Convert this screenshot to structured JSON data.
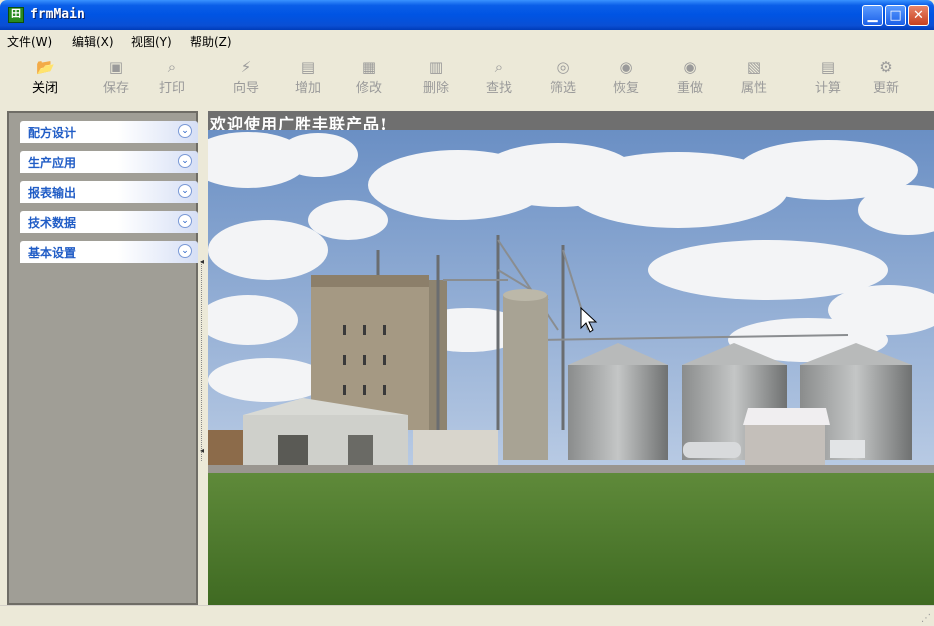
{
  "window": {
    "title": "frmMain",
    "app_icon": "app-icon"
  },
  "menu": [
    "文件(W)",
    "编辑(X)",
    "视图(Y)",
    "帮助(Z)"
  ],
  "toolbar": [
    {
      "label": "关闭",
      "icon": "open-folder-icon",
      "enabled": true
    },
    {
      "label": "保存",
      "icon": "save-icon",
      "enabled": false
    },
    {
      "label": "打印",
      "icon": "print-icon",
      "enabled": false
    },
    {
      "label": "向导",
      "icon": "wizard-icon",
      "enabled": false
    },
    {
      "label": "增加",
      "icon": "add-icon",
      "enabled": false
    },
    {
      "label": "修改",
      "icon": "edit-icon",
      "enabled": false
    },
    {
      "label": "删除",
      "icon": "delete-icon",
      "enabled": false
    },
    {
      "label": "查找",
      "icon": "find-icon",
      "enabled": false
    },
    {
      "label": "筛选",
      "icon": "filter-icon",
      "enabled": false
    },
    {
      "label": "恢复",
      "icon": "restore-icon",
      "enabled": false
    },
    {
      "label": "重做",
      "icon": "redo-icon",
      "enabled": false
    },
    {
      "label": "属性",
      "icon": "properties-icon",
      "enabled": false
    },
    {
      "label": "计算",
      "icon": "calculator-icon",
      "enabled": false
    },
    {
      "label": "更新",
      "icon": "update-icon",
      "enabled": false
    }
  ],
  "sidebar": {
    "items": [
      {
        "label": "配方设计"
      },
      {
        "label": "生产应用"
      },
      {
        "label": "报表输出"
      },
      {
        "label": "技术数据"
      },
      {
        "label": "基本设置"
      }
    ]
  },
  "main": {
    "welcome": "欢迎使用广胜丰联产品!"
  },
  "colors": {
    "titlebar": "#0054e3",
    "sidebar_bg": "#a09e96",
    "sidebar_label": "#215dc6",
    "welcome_bar": "#6f6f6f"
  }
}
